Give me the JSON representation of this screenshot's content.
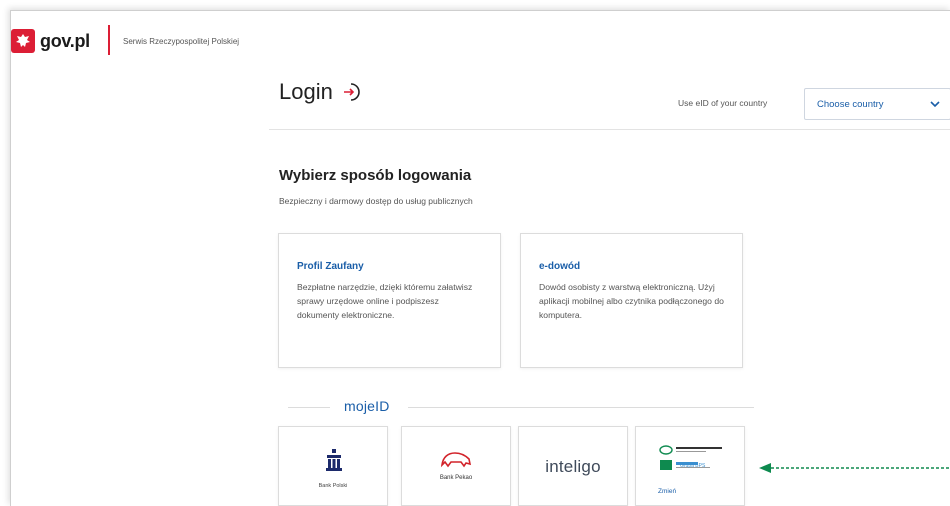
{
  "header": {
    "logo_text": "gov.pl",
    "service_name": "Serwis Rzeczypospolitej Polskiej"
  },
  "login": {
    "title": "Login",
    "eid_label": "Use eID of your country",
    "country_select_value": "Choose country"
  },
  "section": {
    "heading": "Wybierz sposób logowania",
    "subheading": "Bezpieczny i darmowy dostęp do usług publicznych"
  },
  "cards": [
    {
      "title": "Profil Zaufany",
      "description": "Bezpłatne narzędzie, dzięki któremu załatwisz sprawy urzędowe online i podpiszesz dokumenty elektroniczne."
    },
    {
      "title": "e-dowód",
      "description": "Dowód osobisty z warstwą elektroniczną. Użyj aplikacji mobilnej albo czytnika podłączonego do komputera."
    }
  ],
  "mojeid": {
    "label": "mojeID"
  },
  "banks": [
    {
      "name": "Bank Polski"
    },
    {
      "name": "Bank Pekao"
    },
    {
      "name": "inteligo"
    },
    {
      "name": "Grupa BPS",
      "change_label": "Zmień"
    }
  ],
  "colors": {
    "accent_blue": "#1a5ea8",
    "brand_red": "#dc1e35",
    "arrow_green": "#0e8a4f"
  }
}
